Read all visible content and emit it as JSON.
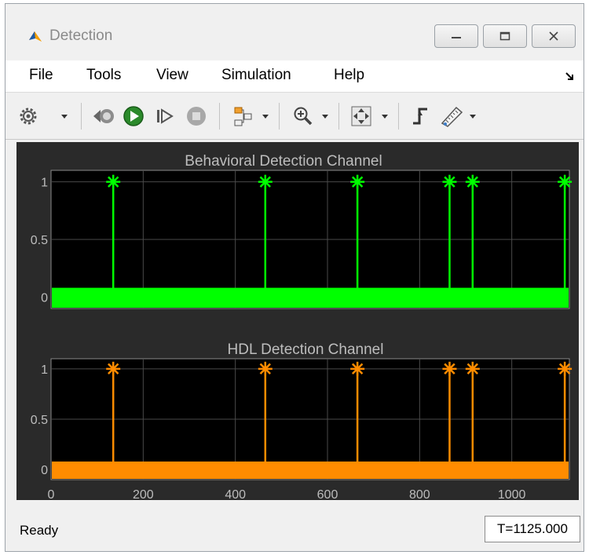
{
  "window": {
    "title": "Detection"
  },
  "menu": {
    "items": [
      "File",
      "Tools",
      "View",
      "Simulation",
      "Help"
    ]
  },
  "toolbar": {
    "icons": [
      "gear-icon",
      "step-back-icon",
      "run-icon",
      "step-forward-icon",
      "stop-icon",
      "highlight-icon",
      "zoom-in-icon",
      "autoscale-icon",
      "trigger-icon",
      "measure-icon"
    ]
  },
  "status": {
    "text": "Ready",
    "time": "T=1125.000"
  },
  "colors": {
    "behavioral": "#00ff00",
    "hdl": "#ff8c00",
    "plot_bg": "#000000",
    "scope_bg": "#2a2a2a"
  },
  "chart_data": [
    {
      "type": "stem",
      "title": "Behavioral Detection Channel",
      "xlim": [
        0,
        1125
      ],
      "ylim": [
        -0.1,
        1.1
      ],
      "yticks": [
        0,
        0.5,
        1
      ],
      "ytick_labels": [
        "0",
        "0.5",
        "1"
      ],
      "xticks": [
        0,
        200,
        400,
        600,
        800,
        1000
      ],
      "xtick_labels": [],
      "grid": true,
      "color": "#00ff00",
      "detections": [
        135,
        465,
        665,
        865,
        915,
        1115
      ]
    },
    {
      "type": "stem",
      "title": "HDL Detection Channel",
      "xlim": [
        0,
        1125
      ],
      "ylim": [
        -0.1,
        1.1
      ],
      "yticks": [
        0,
        0.5,
        1
      ],
      "ytick_labels": [
        "0",
        "0.5",
        "1"
      ],
      "xticks": [
        0,
        200,
        400,
        600,
        800,
        1000
      ],
      "xtick_labels": [
        "0",
        "200",
        "400",
        "600",
        "800",
        "1000"
      ],
      "grid": true,
      "color": "#ff8c00",
      "detections": [
        135,
        465,
        665,
        865,
        915,
        1115
      ]
    }
  ]
}
